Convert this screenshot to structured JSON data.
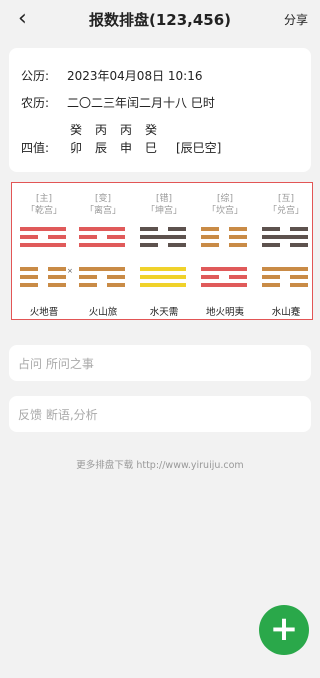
{
  "header": {
    "title": "报数排盘(123,456)",
    "share_label": "分享",
    "back_icon": "‹"
  },
  "info": {
    "gongli_label": "公历:",
    "gongli_value": "2023年04月08日 10:16",
    "nongli_label": "农历:",
    "nongli_value": "二〇二三年闰二月十八 巳时",
    "gan": [
      "癸",
      "丙",
      "丙",
      "癸"
    ],
    "sizhi_label": "四值:",
    "zhi": [
      "卯",
      "辰",
      "申",
      "巳"
    ],
    "kong": "[辰巳空]"
  },
  "hexagrams": [
    {
      "tag": "[主]",
      "palace": "「乾宫」",
      "name": "火地晋",
      "lines": [
        "yang",
        "yin",
        "yang",
        "yin",
        "yin",
        "yin"
      ],
      "color": "#e05a5a"
    },
    {
      "tag": "[变]",
      "palace": "「离宫」",
      "name": "火山旅",
      "lines": [
        "yang",
        "yin",
        "yang",
        "yang",
        "yin",
        "yin"
      ],
      "color": "#e05a5a"
    },
    {
      "tag": "[错]",
      "palace": "「坤宫」",
      "name": "水天需",
      "lines": [
        "yin",
        "yang",
        "yin",
        "yang",
        "yang",
        "yang"
      ],
      "color": "#5d524e"
    },
    {
      "tag": "[综]",
      "palace": "「坎宫」",
      "name": "地火明夷",
      "lines": [
        "yin",
        "yin",
        "yin",
        "yang",
        "yin",
        "yang"
      ],
      "color": "#c98b46"
    },
    {
      "tag": "[互]",
      "palace": "「兑宫」",
      "name": "水山蹇",
      "lines": [
        "yin",
        "yang",
        "yin",
        "yang",
        "yin",
        "yin"
      ],
      "color": "#5d524e"
    }
  ],
  "line_colors": [
    [
      "#e05a5a",
      "#e05a5a",
      "#e05a5a",
      "#c98b46",
      "#c98b46",
      "#c98b46"
    ],
    [
      "#e05a5a",
      "#e05a5a",
      "#e05a5a",
      "#c98b46",
      "#c98b46",
      "#c98b46"
    ],
    [
      "#5d524e",
      "#5d524e",
      "#5d524e",
      "#f0d22a",
      "#f0d22a",
      "#f0d22a"
    ],
    [
      "#c98b46",
      "#c98b46",
      "#c98b46",
      "#e05a5a",
      "#e05a5a",
      "#e05a5a"
    ],
    [
      "#5d524e",
      "#5d524e",
      "#5d524e",
      "#c98b46",
      "#c98b46",
      "#c98b46"
    ]
  ],
  "moving_marker": "×",
  "inputs": {
    "question_placeholder": "占问 所问之事",
    "feedback_placeholder": "反馈 断语,分析"
  },
  "footer": "更多排盘下载 http://www.yiruiju.com",
  "fab_label": "+"
}
